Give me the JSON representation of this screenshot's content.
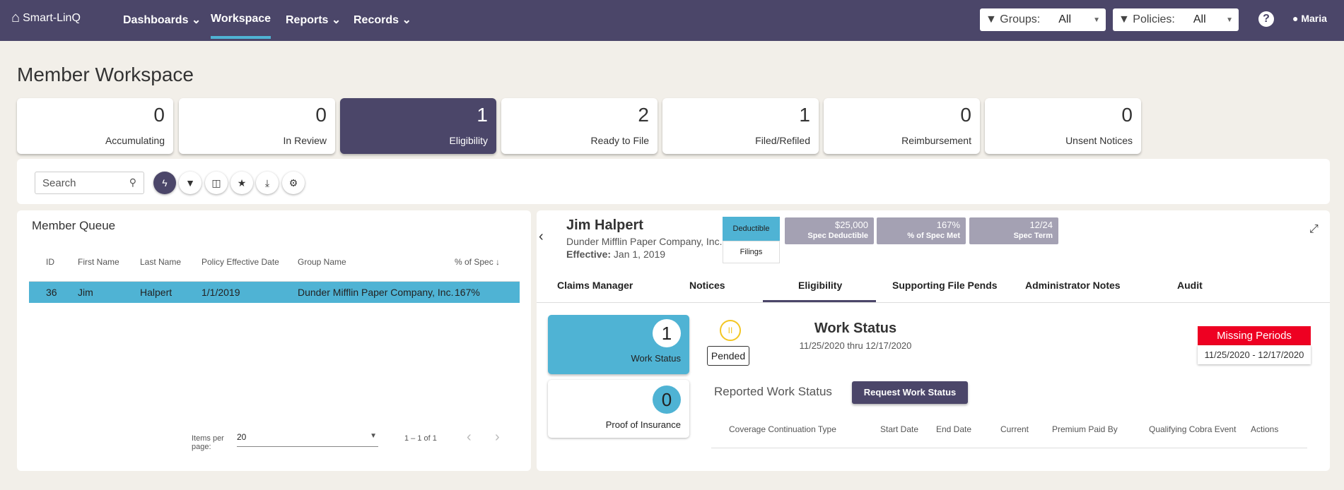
{
  "nav": {
    "brand": "Smart-LinQ",
    "items": [
      {
        "label": "Dashboards",
        "caret": true
      },
      {
        "label": "Workspace",
        "active": true
      },
      {
        "label": "Reports",
        "caret": true
      },
      {
        "label": "Records",
        "caret": true
      }
    ],
    "groups_label": "Groups:",
    "groups_value": "All",
    "policies_label": "Policies:",
    "policies_value": "All",
    "user": "Maria"
  },
  "page_title": "Member Workspace",
  "cards": [
    {
      "count": "0",
      "label": "Accumulating"
    },
    {
      "count": "0",
      "label": "In Review"
    },
    {
      "count": "1",
      "label": "Eligibility"
    },
    {
      "count": "2",
      "label": "Ready to File"
    },
    {
      "count": "1",
      "label": "Filed/Refiled"
    },
    {
      "count": "0",
      "label": "Reimbursement"
    },
    {
      "count": "0",
      "label": "Unsent Notices"
    }
  ],
  "toolbar": {
    "search_placeholder": "Search"
  },
  "queue": {
    "title": "Member Queue",
    "columns": [
      "ID",
      "First Name",
      "Last Name",
      "Policy Effective Date",
      "Group Name",
      "% of Spec"
    ],
    "rows": [
      [
        "36",
        "Jim",
        "Halpert",
        "1/1/2019",
        "Dunder Mifflin Paper Company, Inc.",
        "167%"
      ]
    ],
    "items_per_page_label": "Items per page:",
    "items_per_page": "20",
    "range": "1 – 1 of 1"
  },
  "member": {
    "name": "Jim Halpert",
    "company": "Dunder Mifflin Paper Company, Inc.",
    "effective_label": "Effective:",
    "effective": "Jan 1, 2019",
    "toggle": [
      "Deductible",
      "Filings"
    ],
    "specs": [
      {
        "value": "$25,000",
        "label": "Spec Deductible"
      },
      {
        "value": "167%",
        "label": "% of Spec Met"
      },
      {
        "value": "12/24",
        "label": "Spec Term"
      }
    ],
    "tabs": [
      "Claims Manager",
      "Notices",
      "Eligibility",
      "Supporting File Pends",
      "Administrator Notes",
      "Audit"
    ]
  },
  "eligibility": {
    "side": [
      {
        "count": "1",
        "label": "Work Status"
      },
      {
        "count": "0",
        "label": "Proof of Insurance"
      }
    ],
    "status": "Pended",
    "title": "Work Status",
    "range": "11/25/2020 thru 12/17/2020",
    "missing_label": "Missing Periods",
    "missing_range": "11/25/2020 - 12/17/2020",
    "reported_label": "Reported Work Status",
    "request_button": "Request Work Status",
    "columns": [
      "Coverage Continuation Type",
      "Start Date",
      "End Date",
      "Current",
      "Premium Paid By",
      "Qualifying Cobra Event",
      "Actions"
    ]
  }
}
